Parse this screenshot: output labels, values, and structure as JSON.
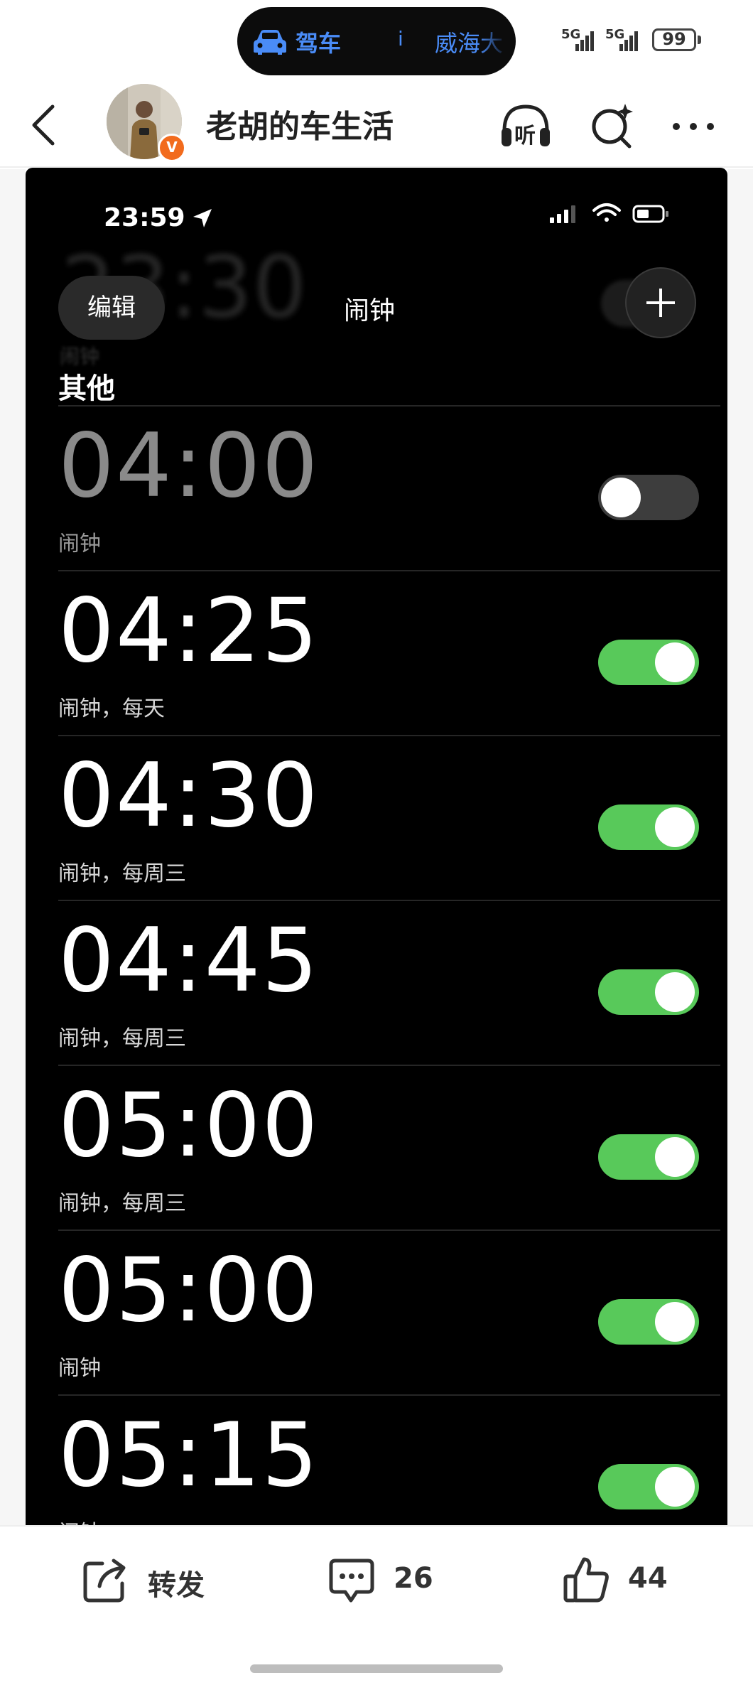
{
  "status_bar": {
    "live_activity_label": "驾车",
    "live_activity_separator": "i",
    "live_activity_location": "威海大",
    "signal_1": "5G",
    "signal_2": "5G",
    "battery_level": "99"
  },
  "header": {
    "account_name": "老胡的车生活",
    "verified_badge": "V",
    "listen_label": "听"
  },
  "alarm_screenshot": {
    "ios_time": "23:59",
    "ghost_time": "23:30",
    "ghost_label": "闹钟",
    "edit_label": "编辑",
    "title": "闹钟",
    "section_title": "其他",
    "alarms": [
      {
        "time": "04:00",
        "label": "闹钟",
        "enabled": false
      },
      {
        "time": "04:25",
        "label": "闹钟，每天",
        "enabled": true
      },
      {
        "time": "04:30",
        "label": "闹钟，每周三",
        "enabled": true
      },
      {
        "time": "04:45",
        "label": "闹钟，每周三",
        "enabled": true
      },
      {
        "time": "05:00",
        "label": "闹钟，每周三",
        "enabled": true
      },
      {
        "time": "05:00",
        "label": "闹钟",
        "enabled": true
      },
      {
        "time": "05:15",
        "label": "闹钟",
        "enabled": true
      }
    ]
  },
  "action_bar": {
    "share_label": "转发",
    "comment_count": "26",
    "like_count": "44"
  },
  "colors": {
    "toggle_on": "#58c95a",
    "toggle_off": "#3d3d3d",
    "live_activity_blue": "#4a8cf7",
    "verified_orange": "#f26b1d"
  },
  "icons": [
    "car-icon",
    "signal-icon",
    "battery-icon",
    "back-arrow-icon",
    "headphones-icon",
    "search-sparkle-icon",
    "more-icon",
    "location-arrow-icon",
    "wifi-icon",
    "plus-icon",
    "share-icon",
    "comment-icon",
    "like-icon"
  ]
}
